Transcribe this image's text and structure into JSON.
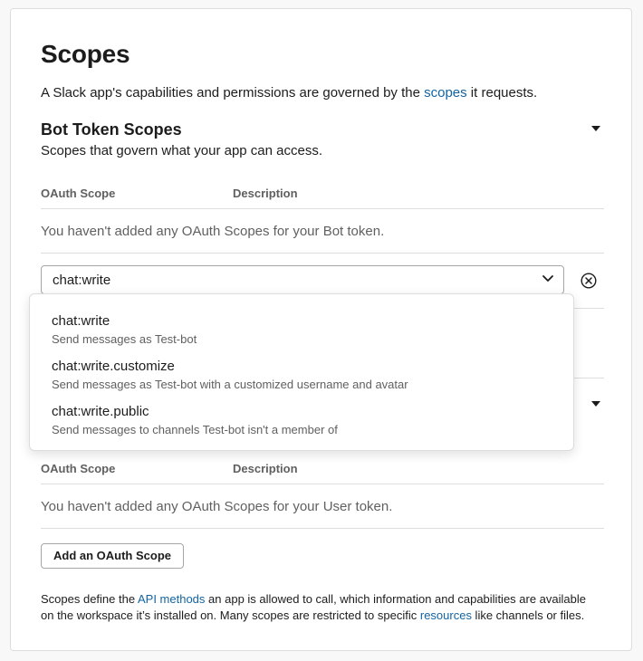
{
  "page": {
    "title": "Scopes",
    "intro": {
      "before": "A Slack app's capabilities and permissions are governed by the ",
      "link": "scopes",
      "after": " it requests."
    }
  },
  "bot": {
    "title": "Bot Token Scopes",
    "subtitle": "Scopes that govern what your app can access.",
    "columns": {
      "scope": "OAuth Scope",
      "description": "Description"
    },
    "empty": "You haven't added any OAuth Scopes for your Bot token.",
    "select_value": "chat:write",
    "options": [
      {
        "label": "chat:write",
        "description": "Send messages as Test-bot"
      },
      {
        "label": "chat:write.customize",
        "description": "Send messages as Test-bot with a customized username and avatar"
      },
      {
        "label": "chat:write.public",
        "description": "Send messages to channels Test-bot isn't a member of"
      }
    ]
  },
  "user": {
    "columns": {
      "scope": "OAuth Scope",
      "description": "Description"
    },
    "empty": "You haven't added any OAuth Scopes for your User token.",
    "add_button": "Add an OAuth Scope"
  },
  "footer": {
    "part1": "Scopes define the ",
    "link1": "API methods",
    "part2": " an app is allowed to call, which information and capabilities are available on the workspace it’s installed on. Many scopes are restricted to specific ",
    "link2": "resources",
    "part3": " like channels or files."
  },
  "colors": {
    "link": "#1264a3",
    "text": "#1d1c1d",
    "muted": "#616061",
    "border": "#dddddd"
  },
  "icons": [
    "caret-down-icon",
    "chevron-down-icon",
    "clear-circle-x-icon"
  ]
}
